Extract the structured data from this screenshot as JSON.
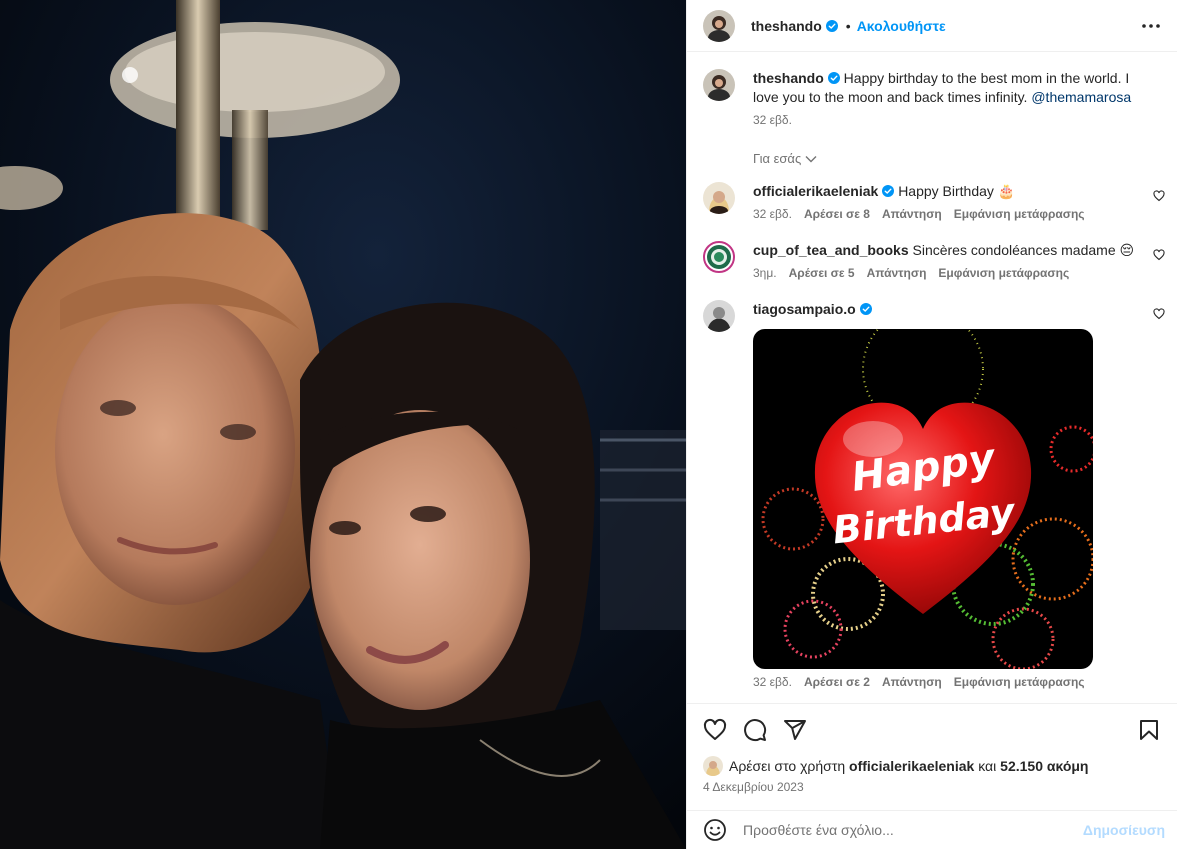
{
  "post": {
    "username": "theshando",
    "follow_label": "Ακολουθήστε",
    "separator": "•"
  },
  "caption": {
    "username": "theshando",
    "text": "Happy birthday to the best mom in the world. I love you to the moon and back times infinity.",
    "mention": "@themamarosa",
    "time": "32 εβδ."
  },
  "for_you_label": "Για εσάς",
  "comments": [
    {
      "username": "officialerikaeleniak",
      "text": "Happy Birthday 🎂",
      "time": "32 εβδ.",
      "likes": "Αρέσει σε 8",
      "reply": "Απάντηση",
      "translate": "Εμφάνιση μετάφρασης"
    },
    {
      "username": "cup_of_tea_and_books",
      "text": "Sincères condoléances madame 😔",
      "time": "3ημ.",
      "likes": "Αρέσει σε 5",
      "reply": "Απάντηση",
      "translate": "Εμφάνιση μετάφρασης"
    },
    {
      "username": "tiagosampaio.o",
      "gif_text_1": "Happy",
      "gif_text_2": "Birthday",
      "time": "32 εβδ.",
      "likes": "Αρέσει σε 2",
      "reply": "Απάντηση",
      "translate": "Εμφάνιση μετάφρασης"
    }
  ],
  "likes": {
    "prefix": "Αρέσει στο χρήστη",
    "user": "officialerikaeleniak",
    "conjunction": "και",
    "others": "52.150 ακόμη"
  },
  "date": "4 Δεκεμβρίου 2023",
  "comment_box": {
    "placeholder": "Προσθέστε ένα σχόλιο...",
    "post_label": "Δημοσίευση"
  },
  "colors": {
    "accent": "#0095f6",
    "verified": "#0095f6",
    "post_disabled": "#b3dbff"
  },
  "icons": [
    "heart-icon",
    "comment-icon",
    "share-icon",
    "bookmark-icon",
    "emoji-icon",
    "more-icon",
    "verified-icon"
  ]
}
